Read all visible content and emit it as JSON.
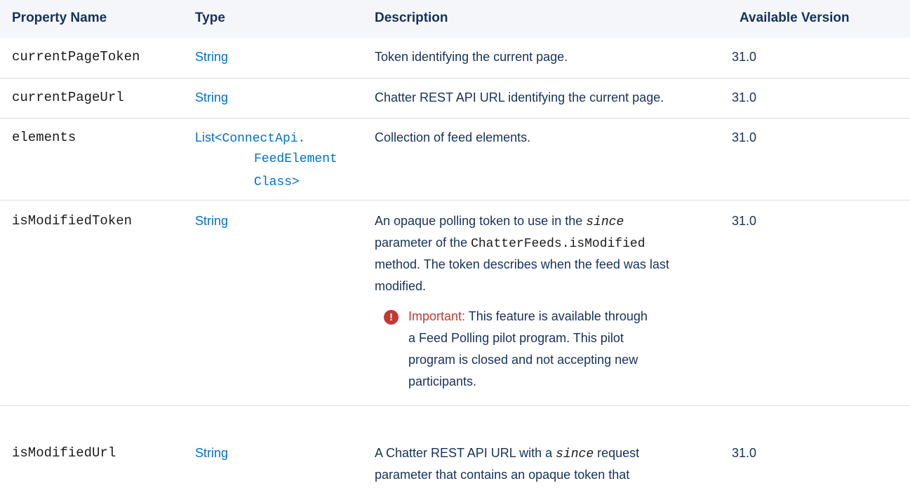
{
  "headers": {
    "property_name": "Property Name",
    "type": "Type",
    "description": "Description",
    "available_version": "Available Version"
  },
  "rows": [
    {
      "name": "currentPageToken",
      "type": "String",
      "description": "Token identifying the current page.",
      "version": "31.0"
    },
    {
      "name": "currentPageUrl",
      "type": "String",
      "description": "Chatter REST API URL identifying the current page.",
      "version": "31.0"
    },
    {
      "name": "elements",
      "type_prefix": "List<",
      "type_line1": "ConnectApi.",
      "type_line2": "FeedElement",
      "type_line3": "Class",
      "type_suffix": ">",
      "description": "Collection of feed elements.",
      "version": "31.0"
    },
    {
      "name": "isModifiedToken",
      "type": "String",
      "desc_line1_a": "An opaque polling token to use in the ",
      "desc_line1_code": "since",
      "desc_line2_a": "parameter of the ",
      "desc_line2_code": "ChatterFeeds.isModified",
      "desc_line3": "method. The token describes when the feed was last",
      "desc_line4": "modified.",
      "important_label": "Important:",
      "important_line1": " This feature is available through",
      "important_line2": "a Feed Polling pilot program. This pilot",
      "important_line3": "program is closed and not accepting new",
      "important_line4": "participants.",
      "version": "31.0"
    },
    {
      "name": "isModifiedUrl",
      "type": "String",
      "desc_line1_a": "A Chatter REST API URL with a ",
      "desc_line1_code": "since",
      "desc_line1_b": " request",
      "desc_line2": "parameter that contains an opaque token that",
      "version": "31.0"
    }
  ]
}
